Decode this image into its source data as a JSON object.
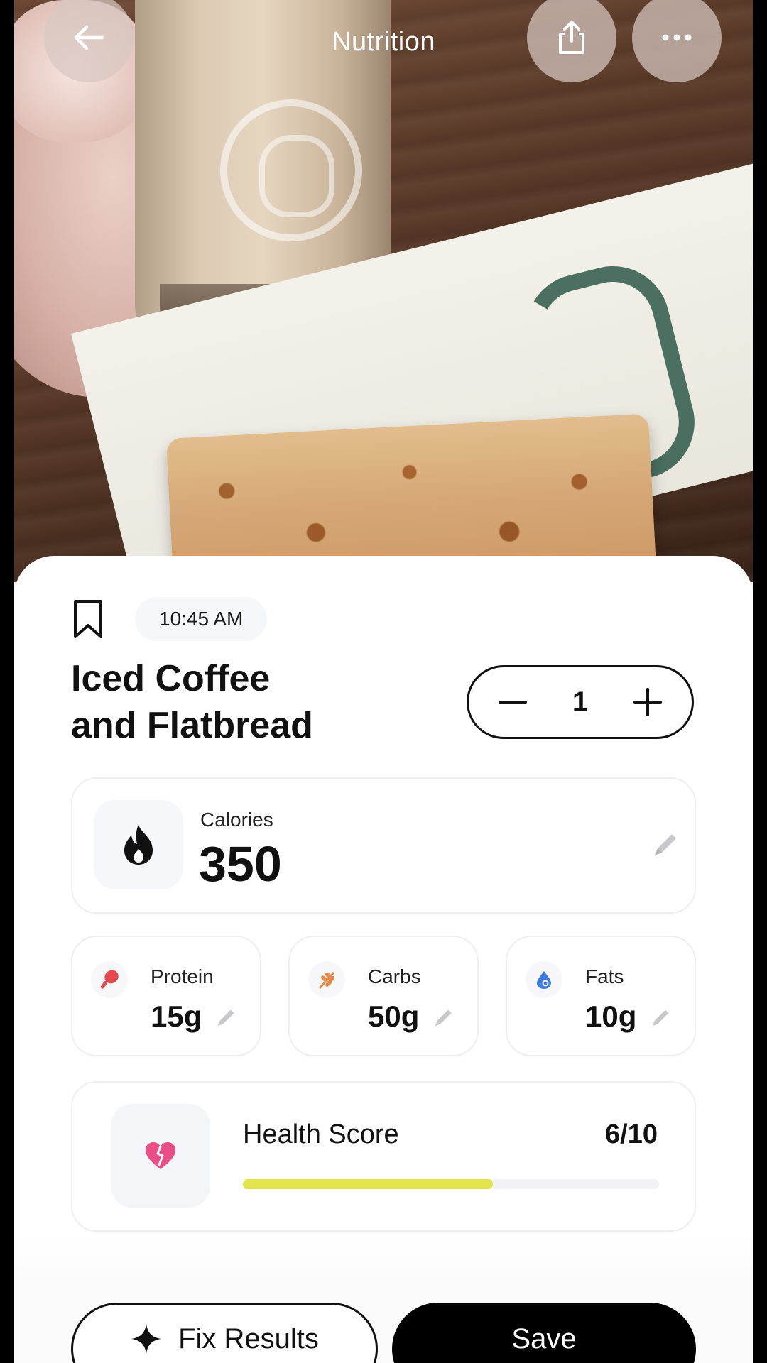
{
  "header": {
    "title": "Nutrition",
    "back_icon": "arrow-left-icon",
    "share_icon": "share-icon",
    "more_icon": "ellipsis-icon"
  },
  "photo": {
    "description_icon": "food-photo"
  },
  "meal": {
    "time": "10:45 AM",
    "title_line1": "Iced Coffee",
    "title_line2": "and Flatbread",
    "quantity": "1"
  },
  "calories": {
    "label": "Calories",
    "value": "350"
  },
  "macros": [
    {
      "label": "Protein",
      "value": "15g",
      "icon": "drumstick-icon",
      "color": "#e5484d"
    },
    {
      "label": "Carbs",
      "value": "50g",
      "icon": "wheat-icon",
      "color": "#e28a4a"
    },
    {
      "label": "Fats",
      "value": "10g",
      "icon": "drop-icon",
      "color": "#3d7be0"
    }
  ],
  "health": {
    "label": "Health Score",
    "value": "6/10",
    "score": 6,
    "max": 10,
    "bar_color": "#e3e44b",
    "icon_color": "#e94f86"
  },
  "actions": {
    "fix_label": "Fix Results",
    "save_label": "Save"
  }
}
